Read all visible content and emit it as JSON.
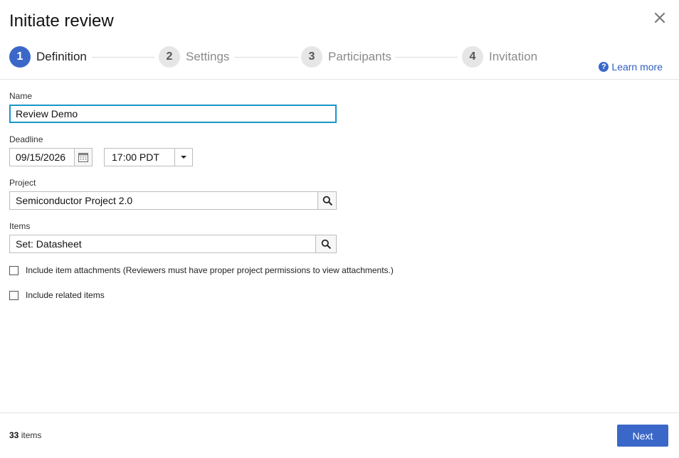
{
  "dialog": {
    "title": "Initiate review",
    "close_icon": "close-icon"
  },
  "steps": [
    {
      "number": "1",
      "label": "Definition",
      "active": true
    },
    {
      "number": "2",
      "label": "Settings",
      "active": false
    },
    {
      "number": "3",
      "label": "Participants",
      "active": false
    },
    {
      "number": "4",
      "label": "Invitation",
      "active": false
    }
  ],
  "learn_more": {
    "label": "Learn more",
    "icon": "help-icon"
  },
  "form": {
    "name": {
      "label": "Name",
      "value": "Review Demo"
    },
    "deadline": {
      "label": "Deadline",
      "date": "09/15/2026",
      "time": "17:00 PDT"
    },
    "project": {
      "label": "Project",
      "value": "Semiconductor Project 2.0"
    },
    "items": {
      "label": "Items",
      "value": "Set: Datasheet"
    },
    "include_attachments": {
      "label": "Include item attachments (Reviewers must have proper project permissions to view attachments.)",
      "checked": false
    },
    "include_related": {
      "label": "Include related items",
      "checked": false
    }
  },
  "footer": {
    "count": "33",
    "count_suffix": " items",
    "next_label": "Next"
  },
  "colors": {
    "accent": "#3b68c8",
    "focus": "#1a96c8"
  }
}
